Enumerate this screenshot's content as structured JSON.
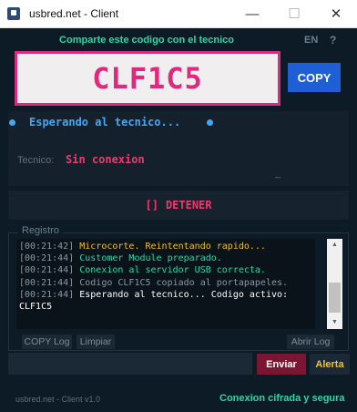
{
  "window": {
    "title": "usbred.net - Client",
    "min_glyph": "—",
    "max_glyph": "☐",
    "close_glyph": "✕"
  },
  "header": {
    "instruction": "Comparte este codigo con el tecnico",
    "lang": "EN",
    "help": "?"
  },
  "code": {
    "value": "CLF1C5",
    "copy_label": "COPY"
  },
  "status": {
    "waiting_text": "Esperando al tecnico...",
    "tech_label": "Tecnico:",
    "tech_value": "Sin conexion",
    "underscore": "_"
  },
  "stop": {
    "icon_text": "[]",
    "label": "DETENER"
  },
  "log": {
    "title": "Registro",
    "lines": [
      {
        "ts": "[00:21:42]",
        "text": "Microcorte. Reintentando rapido..."
      },
      {
        "ts": "[00:21:44]",
        "text": "Customer Module preparado."
      },
      {
        "ts": "[00:21:44]",
        "text": "Conexion al servidor USB correcta."
      },
      {
        "ts": "[00:21:44]",
        "text": "Codigo CLF1C5 copiado al portapapeles."
      },
      {
        "ts": "[00:21:44]",
        "text": "Esperando al tecnico... Codigo activo:"
      },
      {
        "ts": "",
        "text": "CLF1C5"
      }
    ],
    "colors": {
      "warn": "#f0c030",
      "ok": "#2fd6a4",
      "muted": "#8c98a3",
      "white": "#ffffff"
    },
    "copy_log_label": "COPY Log",
    "clear_label": "Limpiar",
    "open_log_label": "Abrir Log"
  },
  "message": {
    "value": "",
    "send_label": "Enviar",
    "alert_label": "Alerta"
  },
  "footer": {
    "left": "usbred.net - Client v1.0",
    "right": "Conexion cifrada y segura"
  },
  "colors": {
    "accent_teal": "#2fd6a4",
    "code_pink": "#e0297c",
    "copy_blue": "#1f5fd6",
    "status_blue": "#46a7f0",
    "danger_pink": "#ec3b6a",
    "send_red": "#7a1631",
    "alert_yellow": "#f0c030"
  }
}
